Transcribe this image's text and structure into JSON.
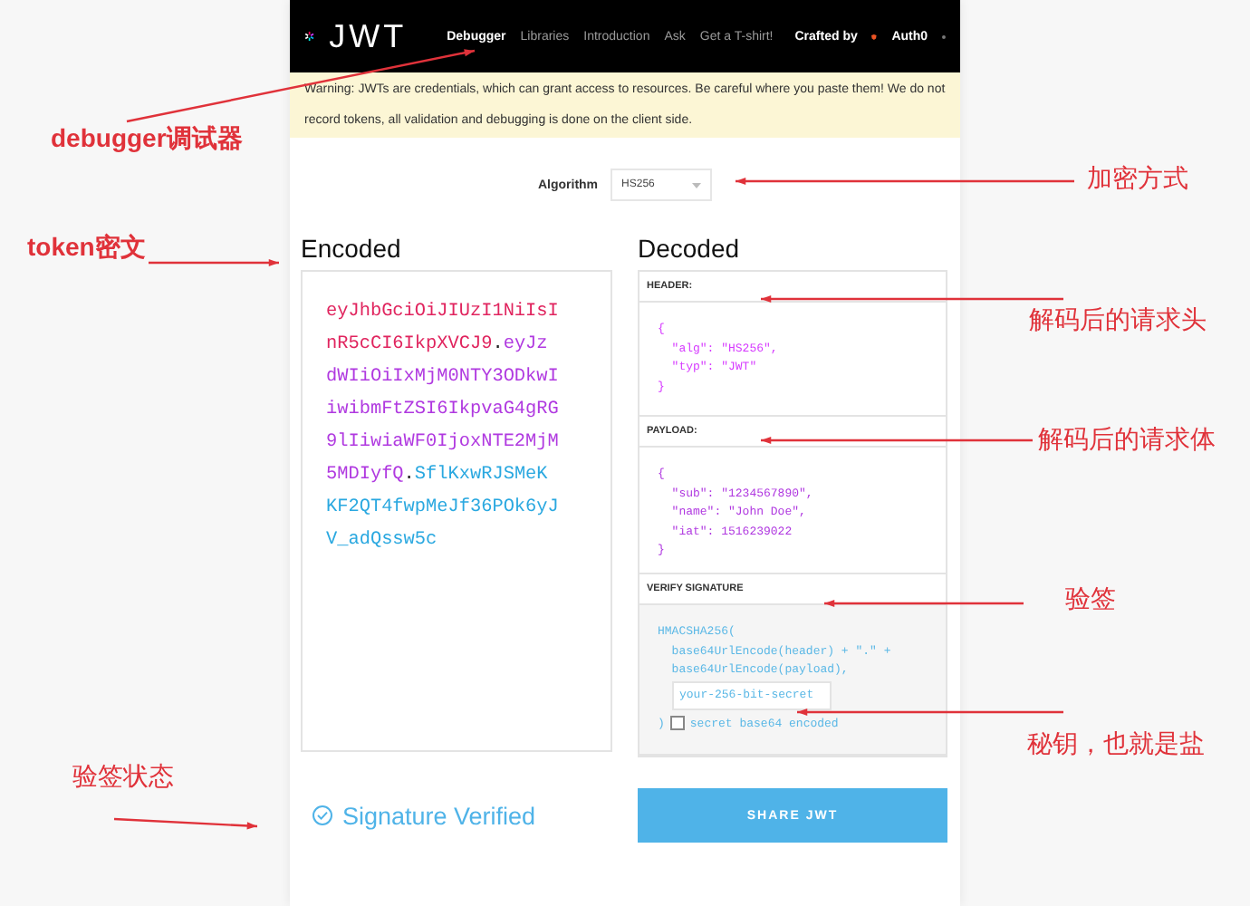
{
  "navbar": {
    "logo_text": "JWT",
    "items": [
      {
        "label": "Debugger",
        "selected": true
      },
      {
        "label": "Libraries",
        "selected": false
      },
      {
        "label": "Introduction",
        "selected": false
      },
      {
        "label": "Ask",
        "selected": false
      },
      {
        "label": "Get a T-shirt!",
        "selected": false
      }
    ],
    "crafted_by": "Crafted by",
    "brand": "Auth0"
  },
  "warning": "Warning: JWTs are credentials, which can grant access to resources. Be careful where you paste them! We do not record tokens, all validation and debugging is done on the client side.",
  "algorithm": {
    "label": "Algorithm",
    "value": "HS256"
  },
  "encoded": {
    "title": "Encoded",
    "segments": [
      {
        "kind": "header",
        "text": "eyJhbGciOiJIUzI1NiIsInR5cCI6IkpXVCJ9"
      },
      {
        "kind": "dot",
        "text": "."
      },
      {
        "kind": "payload",
        "text": "eyJzdWIiOiIxMjM0NTY3ODkwIiwibmFtZSI6IkpvaG4gRG9lIiwiaWF0IjoxNTE2MjM5MDIyfQ"
      },
      {
        "kind": "dot",
        "text": "."
      },
      {
        "kind": "signature",
        "text": "SflKxwRJSMeKKF2QT4fwpMeJf36POk6yJV_adQssw5c"
      }
    ]
  },
  "decoded": {
    "title": "Decoded",
    "header": {
      "label": "HEADER:",
      "lines": [
        "{",
        "  \"alg\": \"HS256\",",
        "  \"typ\": \"JWT\"",
        "}"
      ]
    },
    "payload": {
      "label": "PAYLOAD:",
      "lines": [
        "{",
        "  \"sub\": \"1234567890\",",
        "  \"name\": \"John Doe\",",
        "  \"iat\": 1516239022",
        "}"
      ]
    },
    "verify": {
      "label": "VERIFY SIGNATURE",
      "lines": [
        "HMACSHA256(",
        "  base64UrlEncode(header) + \".\" +",
        "  base64UrlEncode(payload),"
      ],
      "secret_placeholder": "your-256-bit-secret",
      "close": ")",
      "base64_checked": false,
      "base64_label": "secret base64 encoded"
    }
  },
  "status": "Signature Verified",
  "share_button": "SHARE JWT",
  "annotations": [
    "debugger调试器",
    "token密文",
    "验签状态",
    "加密方式",
    "解码后的请求头",
    "解码后的请求体",
    "验签",
    "秘钥，也就是盐"
  ]
}
